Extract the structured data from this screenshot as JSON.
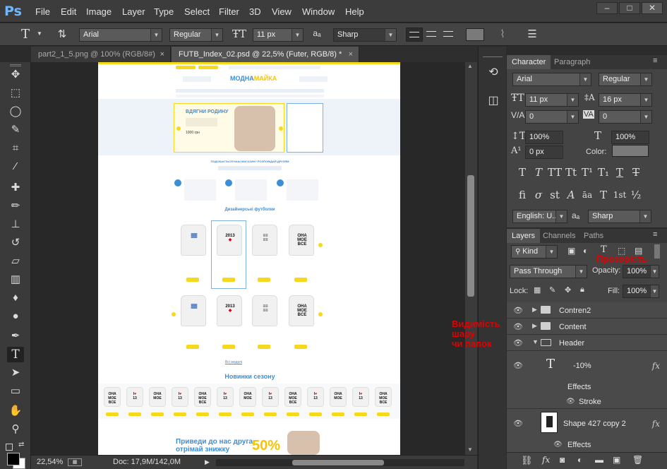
{
  "app": {
    "logo": "Ps"
  },
  "menu": [
    "File",
    "Edit",
    "Image",
    "Layer",
    "Type",
    "Select",
    "Filter",
    "3D",
    "View",
    "Window",
    "Help"
  ],
  "window_buttons": [
    "–",
    "□",
    "✕"
  ],
  "options_bar": {
    "tool_icon": "T",
    "font_family": "Arial",
    "font_style": "Regular",
    "font_size": "11 px",
    "aa_label": "aₐ",
    "antialias": "Sharp"
  },
  "tabs": [
    {
      "label": "part2_1_5.png @ 100% (RGB/8#)",
      "close": "×"
    },
    {
      "label": "FUTB_Index_02.psd @ 22,5% (Futer, RGB/8) *",
      "close": "×"
    }
  ],
  "status": {
    "zoom": "22,54%",
    "doc": "Doc: 17,9M/142,0M"
  },
  "character_panel": {
    "tabs": [
      "Character",
      "Paragraph"
    ],
    "font_family": "Arial",
    "font_style": "Regular",
    "font_size": "11 px",
    "leading": "16 px",
    "kerning": "0",
    "tracking": "0",
    "vscale": "100%",
    "hscale": "100%",
    "baseline": "0 px",
    "color_label": "Color:",
    "style_glyphs": [
      "T",
      "T",
      "TT",
      "Tt",
      "T¹",
      "T₁",
      "T",
      "T"
    ],
    "ot_glyphs": [
      "fi",
      "σ",
      "st",
      "A",
      "āa",
      "T",
      "1st",
      "½"
    ],
    "language": "English: U...",
    "antialias": "Sharp",
    "aa_label": "aₐ"
  },
  "layers_panel": {
    "tabs": [
      "Layers",
      "Channels",
      "Paths"
    ],
    "filter": "Kind",
    "blend_mode": "Pass Through",
    "opacity_label": "Opacity:",
    "opacity": "100%",
    "lock_label": "Lock:",
    "fill_label": "Fill:",
    "fill": "100%",
    "layers": [
      {
        "name": "Contren2",
        "type": "folder"
      },
      {
        "name": "Content",
        "type": "folder"
      },
      {
        "name": "Header",
        "type": "folder-open"
      },
      {
        "name": "-10%",
        "type": "text",
        "fx": "fx"
      },
      {
        "name": "Effects",
        "type": "sub"
      },
      {
        "name": "Stroke",
        "type": "subeffect"
      },
      {
        "name": "Shape 427 copy 2",
        "type": "shape",
        "fx": "fx"
      },
      {
        "name": "Effects",
        "type": "sub"
      }
    ]
  },
  "annotations": {
    "opacity_note": "Прозорість",
    "visibility_note_1": "Видимість",
    "visibility_note_2": "шару",
    "visibility_note_3": "чи папок"
  },
  "webpage": {
    "logo_main": "МОДНА",
    "logo_accent": "МАЙКА",
    "hero_title": "ВДЯГНИ РОДИНУ",
    "hero_price": "1000 грн",
    "share_title": "ПОДОБАЄТЬСЯ НАШ МАГАЗИН? РОЗПОВІДАЙ ДРУЗЯМ",
    "designer_title": "Дизайнерські футболки",
    "more_link": "Всі моделі",
    "new_title": "Новинки сезону",
    "promo_line1": "Приведи до нас друга",
    "promo_line2": "отрімай знижку",
    "promo_pct": "50%"
  },
  "colors": {
    "accent_blue": "#3b8ed8",
    "yellow": "#f6d81c",
    "annot_red": "#e10000"
  }
}
